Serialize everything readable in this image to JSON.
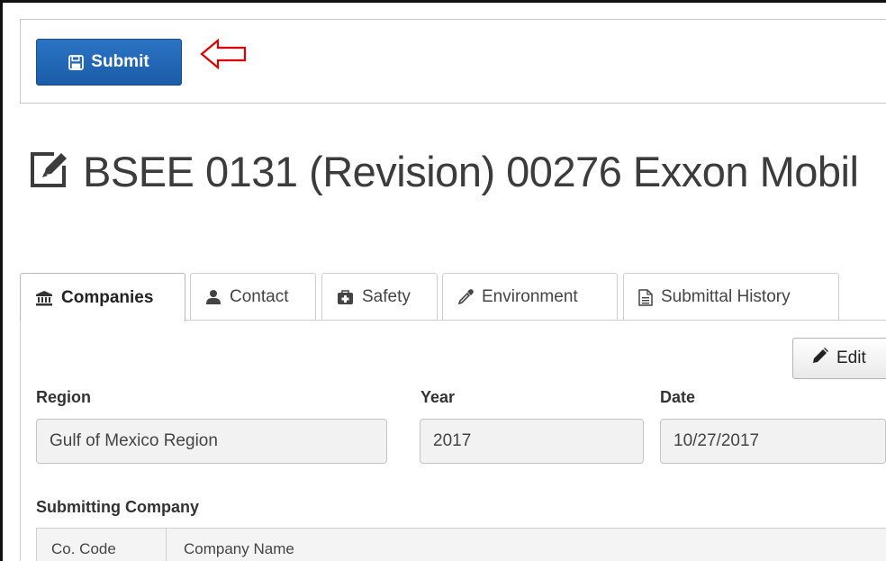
{
  "toolbar": {
    "submit_label": "Submit"
  },
  "page": {
    "title": "BSEE 0131 (Revision) 00276 Exxon Mobil"
  },
  "tabs": [
    {
      "label": "Companies",
      "icon": "bank-icon",
      "active": true
    },
    {
      "label": "Contact",
      "icon": "user-icon",
      "active": false
    },
    {
      "label": "Safety",
      "icon": "medkit-icon",
      "active": false
    },
    {
      "label": "Environment",
      "icon": "eyedropper-icon",
      "active": false
    },
    {
      "label": "Submittal History",
      "icon": "file-text-icon",
      "active": false
    }
  ],
  "actions": {
    "edit_label": "Edit"
  },
  "form": {
    "region_label": "Region",
    "region_value": "Gulf of Mexico Region",
    "year_label": "Year",
    "year_value": "2017",
    "date_label": "Date",
    "date_value": "10/27/2017"
  },
  "submitting_company": {
    "heading": "Submitting Company",
    "columns": [
      "Co. Code",
      "Company Name"
    ]
  },
  "colors": {
    "primary": "#1f63b0",
    "arrow": "#e00000",
    "field_bg": "#f2f2f2"
  }
}
